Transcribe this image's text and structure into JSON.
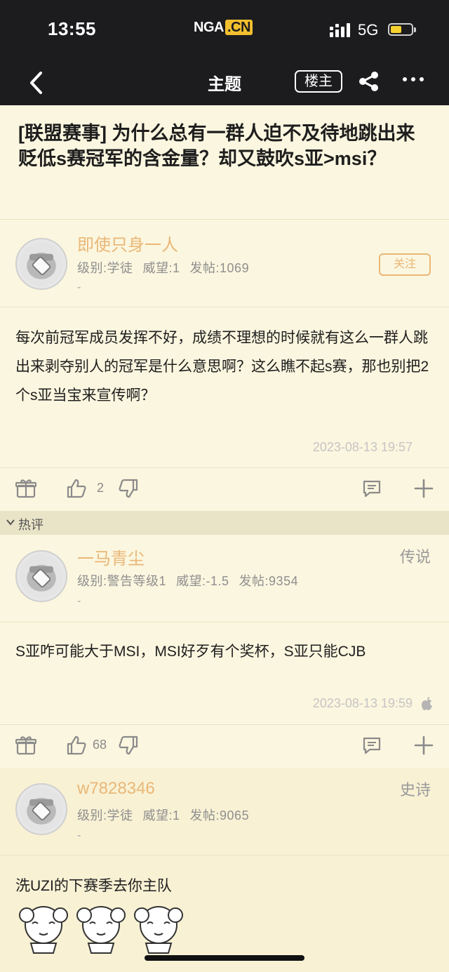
{
  "status_bar": {
    "time": "13:55",
    "logo_main": "NGA",
    "logo_cn": ".CN",
    "network": "5G"
  },
  "navbar": {
    "title": "主题",
    "owner_button": "楼主"
  },
  "topic": {
    "title": "[联盟赛事] 为什么总有一群人迫不及待地跳出来贬低s赛冠军的含金量？却又鼓吹s亚>msi？"
  },
  "posts": [
    {
      "username": "即使只身一人",
      "level": "级别:学徒",
      "prestige": "威望:1",
      "posts": "发帖:1069",
      "dash": "-",
      "follow_label": "关注",
      "content": "每次前冠军成员发挥不好，成绩不理想的时候就有这么一群人跳出来剥夺别人的冠军是什么意思啊？这么瞧不起s赛，那也别把2个s亚当宝来宣传啊？",
      "date": "2023-08-13 19:57",
      "likes": "2"
    },
    {
      "username": "一马青尘",
      "rank": "传说",
      "level": "级别:警告等级1",
      "prestige": "威望:-1.5",
      "posts": "发帖:9354",
      "dash": "-",
      "content": "S亚咋可能大于MSI，MSI好歹有个奖杯，S亚只能CJB",
      "date": "2023-08-13 19:59",
      "likes": "68"
    },
    {
      "username": "w7828346",
      "rank": "史诗",
      "level": "级别:学徒",
      "prestige": "威望:1",
      "posts": "发帖:9065",
      "dash": "-",
      "content": "洗UZI的下赛季去你主队"
    }
  ],
  "hot_section_label": "热评",
  "colors": {
    "background": "#fbf6df",
    "bar": "#1c1c1e",
    "username": "#eab777",
    "hotbar": "#e9e3c7"
  }
}
